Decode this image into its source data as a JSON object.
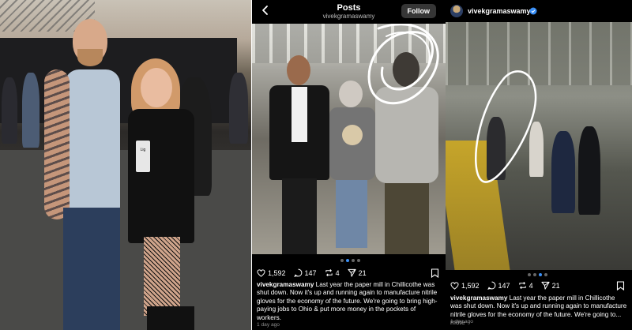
{
  "panel_post": {
    "header_title": "Posts",
    "header_subtitle": "vivekgramaswamy",
    "follow_label": "Follow",
    "likes": "1,592",
    "comments": "147",
    "reposts": "4",
    "shares": "21",
    "username": "vivekgramaswamy",
    "caption": "Last year the paper mill in Chillicothe was shut down. Now it's up and running again to manufacture nitrile gloves for the economy of the future. We're going to bring high-paying jobs to Ohio & put more money in the pockets of workers.",
    "time": "1 day ago"
  },
  "panel_post2": {
    "username": "vivekgramaswamy",
    "likes": "1,592",
    "comments": "147",
    "reposts": "4",
    "shares": "21",
    "caption": "Last year the paper mill in Chillicothe was shut down. Now it's up and running again to manufacture nitrile gloves for the economy of the future. We're going to...",
    "more": "more",
    "time": "1 day ago"
  },
  "photo1": {
    "can_text": "Lig"
  },
  "colors": {
    "accent_blue": "#3a8ff6",
    "background": "#000000",
    "muted_text": "#8e8e8e",
    "annotation_white": "#ffffff"
  },
  "icons": [
    "back-arrow-icon",
    "heart-icon",
    "comment-icon",
    "repost-icon",
    "share-icon",
    "bookmark-icon",
    "verified-icon"
  ]
}
